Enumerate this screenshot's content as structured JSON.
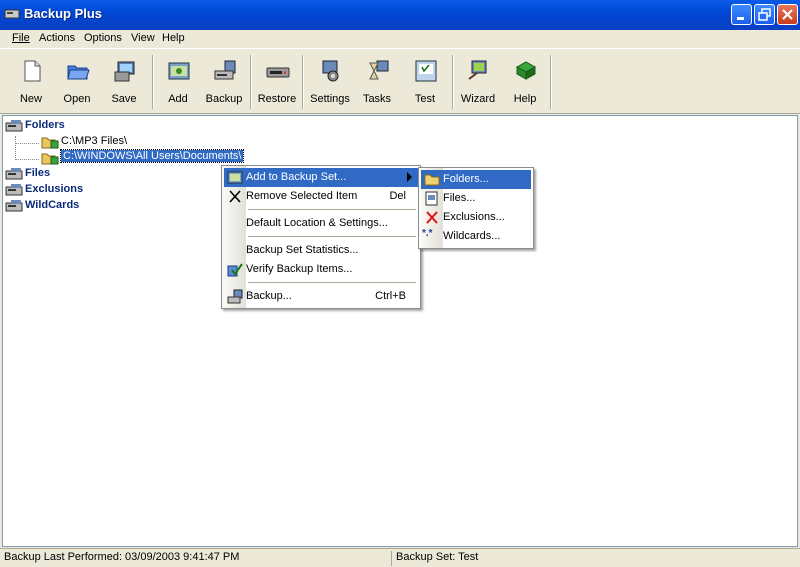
{
  "window": {
    "title": "Backup Plus"
  },
  "menubar": {
    "items": [
      {
        "label": "File"
      },
      {
        "label": "Actions"
      },
      {
        "label": "Options"
      },
      {
        "label": "View"
      },
      {
        "label": "Help"
      }
    ]
  },
  "toolbar": {
    "buttons": [
      {
        "label": "New",
        "icon": "new-document-icon"
      },
      {
        "label": "Open",
        "icon": "open-folder-icon"
      },
      {
        "label": "Save",
        "icon": "save-icon"
      },
      {
        "label": "Add",
        "icon": "add-icon"
      },
      {
        "label": "Backup",
        "icon": "backup-icon"
      },
      {
        "label": "Restore",
        "icon": "restore-icon"
      },
      {
        "label": "Settings",
        "icon": "settings-icon"
      },
      {
        "label": "Tasks",
        "icon": "tasks-icon"
      },
      {
        "label": "Test",
        "icon": "test-icon"
      },
      {
        "label": "Wizard",
        "icon": "wizard-icon"
      },
      {
        "label": "Help",
        "icon": "help-book-icon"
      }
    ]
  },
  "tree": {
    "folders": {
      "label": "Folders",
      "children": [
        {
          "label": "C:\\MP3 Files\\"
        },
        {
          "label": "C:\\WINDOWS\\All Users\\Documents\\"
        }
      ]
    },
    "files": {
      "label": "Files"
    },
    "exclusions": {
      "label": "Exclusions"
    },
    "wildcards": {
      "label": "WildCards"
    }
  },
  "context_menu": {
    "add_to_backup_set": "Add to Backup Set...",
    "remove_selected": "Remove Selected Item",
    "remove_shortcut": "Del",
    "default_location": "Default Location & Settings...",
    "statistics": "Backup Set Statistics...",
    "verify": "Verify Backup Items...",
    "backup": "Backup...",
    "backup_shortcut": "Ctrl+B"
  },
  "submenu": {
    "folders": "Folders...",
    "files": "Files...",
    "exclusions": "Exclusions...",
    "wildcards": "Wildcards...",
    "wildcards_glyph": "*.*"
  },
  "statusbar": {
    "last_performed": "Backup Last Performed:  03/09/2003 9:41:47 PM",
    "backup_set": "Backup Set:  Test"
  },
  "colors": {
    "titlebar": "#0047d6",
    "selection": "#316ac5",
    "face": "#ece9d8"
  }
}
